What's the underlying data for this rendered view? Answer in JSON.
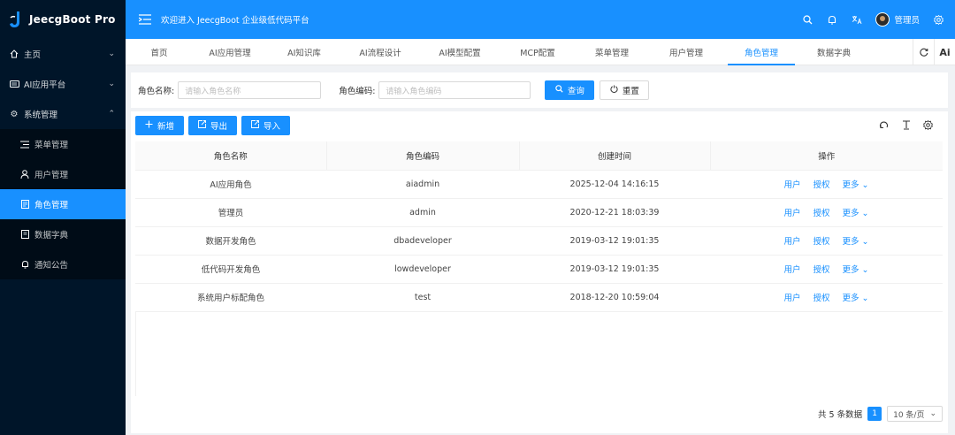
{
  "app": {
    "title": "JeecgBoot Pro",
    "brand_color": "#1890ff"
  },
  "sidebar": {
    "items": [
      {
        "label": "主页",
        "icon": "home-icon",
        "chevron": "down"
      },
      {
        "label": "AI应用平台",
        "icon": "ai-icon",
        "chevron": "down"
      },
      {
        "label": "系统管理",
        "icon": "gear-icon",
        "chevron": "up"
      }
    ],
    "sub_items": [
      {
        "label": "菜单管理",
        "icon": "menu-list-icon"
      },
      {
        "label": "用户管理",
        "icon": "user-icon"
      },
      {
        "label": "角色管理",
        "icon": "role-icon",
        "active": true
      },
      {
        "label": "数据字典",
        "icon": "dictionary-icon"
      },
      {
        "label": "通知公告",
        "icon": "bell-icon"
      }
    ]
  },
  "header": {
    "welcome": "欢迎进入 JeecgBoot 企业级低代码平台",
    "username": "管理员"
  },
  "tabs": [
    {
      "label": "首页"
    },
    {
      "label": "AI应用管理"
    },
    {
      "label": "AI知识库"
    },
    {
      "label": "AI流程设计"
    },
    {
      "label": "AI模型配置"
    },
    {
      "label": "MCP配置"
    },
    {
      "label": "菜单管理"
    },
    {
      "label": "用户管理"
    },
    {
      "label": "角色管理",
      "active": true
    },
    {
      "label": "数据字典"
    }
  ],
  "tab_tools": {
    "ai_label": "Ai"
  },
  "search": {
    "role_name_label": "角色名称:",
    "role_name_placeholder": "请输入角色名称",
    "role_code_label": "角色编码:",
    "role_code_placeholder": "请输入角色编码",
    "query_label": "查询",
    "reset_label": "重置"
  },
  "toolbar": {
    "add_label": "新增",
    "export_label": "导出",
    "import_label": "导入"
  },
  "table": {
    "headers": [
      "角色名称",
      "角色编码",
      "创建时间",
      "操作"
    ],
    "rows": [
      {
        "name": "AI应用角色",
        "code": "aiadmin",
        "created": "2025-12-04 14:16:15"
      },
      {
        "name": "管理员",
        "code": "admin",
        "created": "2020-12-21 18:03:39"
      },
      {
        "name": "数据开发角色",
        "code": "dbadeveloper",
        "created": "2019-03-12 19:01:35"
      },
      {
        "name": "低代码开发角色",
        "code": "lowdeveloper",
        "created": "2019-03-12 19:01:35"
      },
      {
        "name": "系统用户标配角色",
        "code": "test",
        "created": "2018-12-20 10:59:04"
      }
    ],
    "ops": {
      "user": "用户",
      "auth": "授权",
      "more": "更多"
    }
  },
  "pager": {
    "total": "共 5 条数据",
    "current_page": "1",
    "page_size": "10 条/页"
  }
}
